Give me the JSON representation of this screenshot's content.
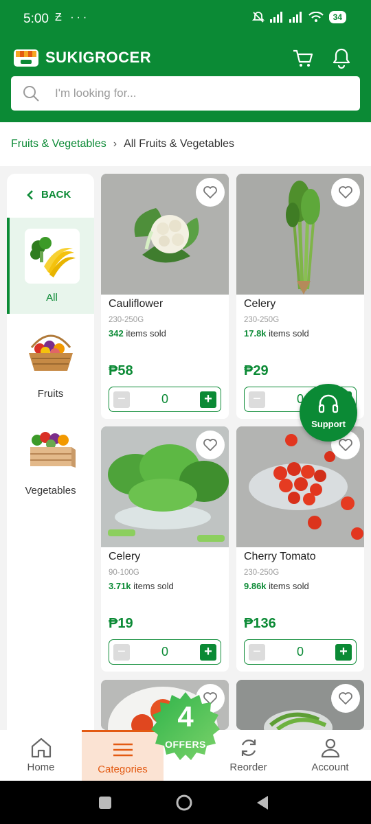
{
  "status_bar": {
    "time": "5:00",
    "left_icons": "Ƶ ···",
    "battery": "34"
  },
  "header": {
    "brand": "SUKIGROCER"
  },
  "search": {
    "placeholder": "I'm looking for..."
  },
  "breadcrumb": {
    "parent": "Fruits & Vegetables",
    "current": "All Fruits & Vegetables"
  },
  "sidebar": {
    "back_label": "BACK",
    "categories": [
      {
        "label": "All",
        "icon": "fruit-veg-mix"
      },
      {
        "label": "Fruits",
        "icon": "fruit-basket"
      },
      {
        "label": "Vegetables",
        "icon": "vegetable-crate"
      }
    ]
  },
  "products": [
    {
      "name": "Cauliflower",
      "weight": "230-250G",
      "sold_count": "342",
      "sold_suffix": "items sold",
      "price": "₱58",
      "qty": "0"
    },
    {
      "name": "Celery",
      "weight": "230-250G",
      "sold_count": "17.8k",
      "sold_suffix": "items sold",
      "price": "₱29",
      "qty": "0"
    },
    {
      "name": "Celery",
      "weight": "90-100G",
      "sold_count": "3.71k",
      "sold_suffix": "items sold",
      "price": "₱19",
      "qty": "0"
    },
    {
      "name": "Cherry Tomato",
      "weight": "230-250G",
      "sold_count": "9.86k",
      "sold_suffix": "items sold",
      "price": "₱136",
      "qty": "0"
    }
  ],
  "support": {
    "label": "Support"
  },
  "offers": {
    "count": "4",
    "label": "OFFERS"
  },
  "bottom_nav": [
    {
      "label": "Home",
      "icon": "home-icon"
    },
    {
      "label": "Categories",
      "icon": "categories-icon",
      "active": true
    },
    {
      "label": "Reorder",
      "icon": "reorder-icon"
    },
    {
      "label": "Account",
      "icon": "account-icon"
    }
  ],
  "colors": {
    "primary": "#0b8a35",
    "accent": "#e35a12",
    "active_bg": "#e8f5ec"
  }
}
